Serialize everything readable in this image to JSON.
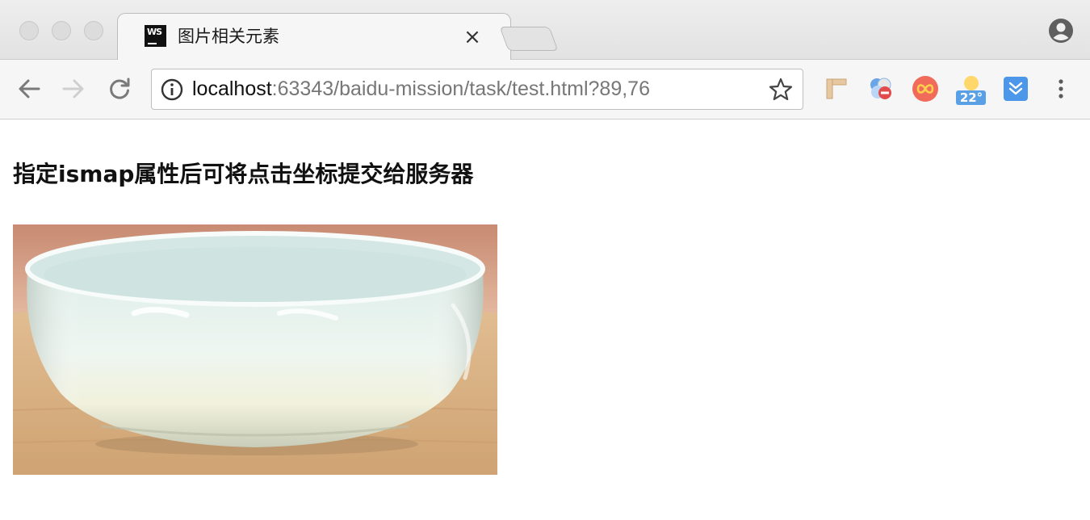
{
  "browser": {
    "tab": {
      "title": "图片相关元素",
      "favicon_text": "WS",
      "close_symbol": "×"
    },
    "address_bar": {
      "host": "localhost",
      "rest": ":63343/baidu-mission/task/test.html?89,76"
    },
    "extensions": [
      {
        "name": "ruler-extension-icon"
      },
      {
        "name": "translate-extension-icon"
      },
      {
        "name": "infinity-extension-icon"
      },
      {
        "name": "weather-extension-icon",
        "text": "22°"
      },
      {
        "name": "download-extension-icon"
      }
    ]
  },
  "page": {
    "heading": "指定ismap属性后可将点击坐标提交给服务器",
    "image": {
      "subject": "white porcelain bowl on wooden table",
      "accent_colors": {
        "background": "#c9876f",
        "table": "#d8a979",
        "bowl": "#e8f3ee"
      }
    }
  }
}
